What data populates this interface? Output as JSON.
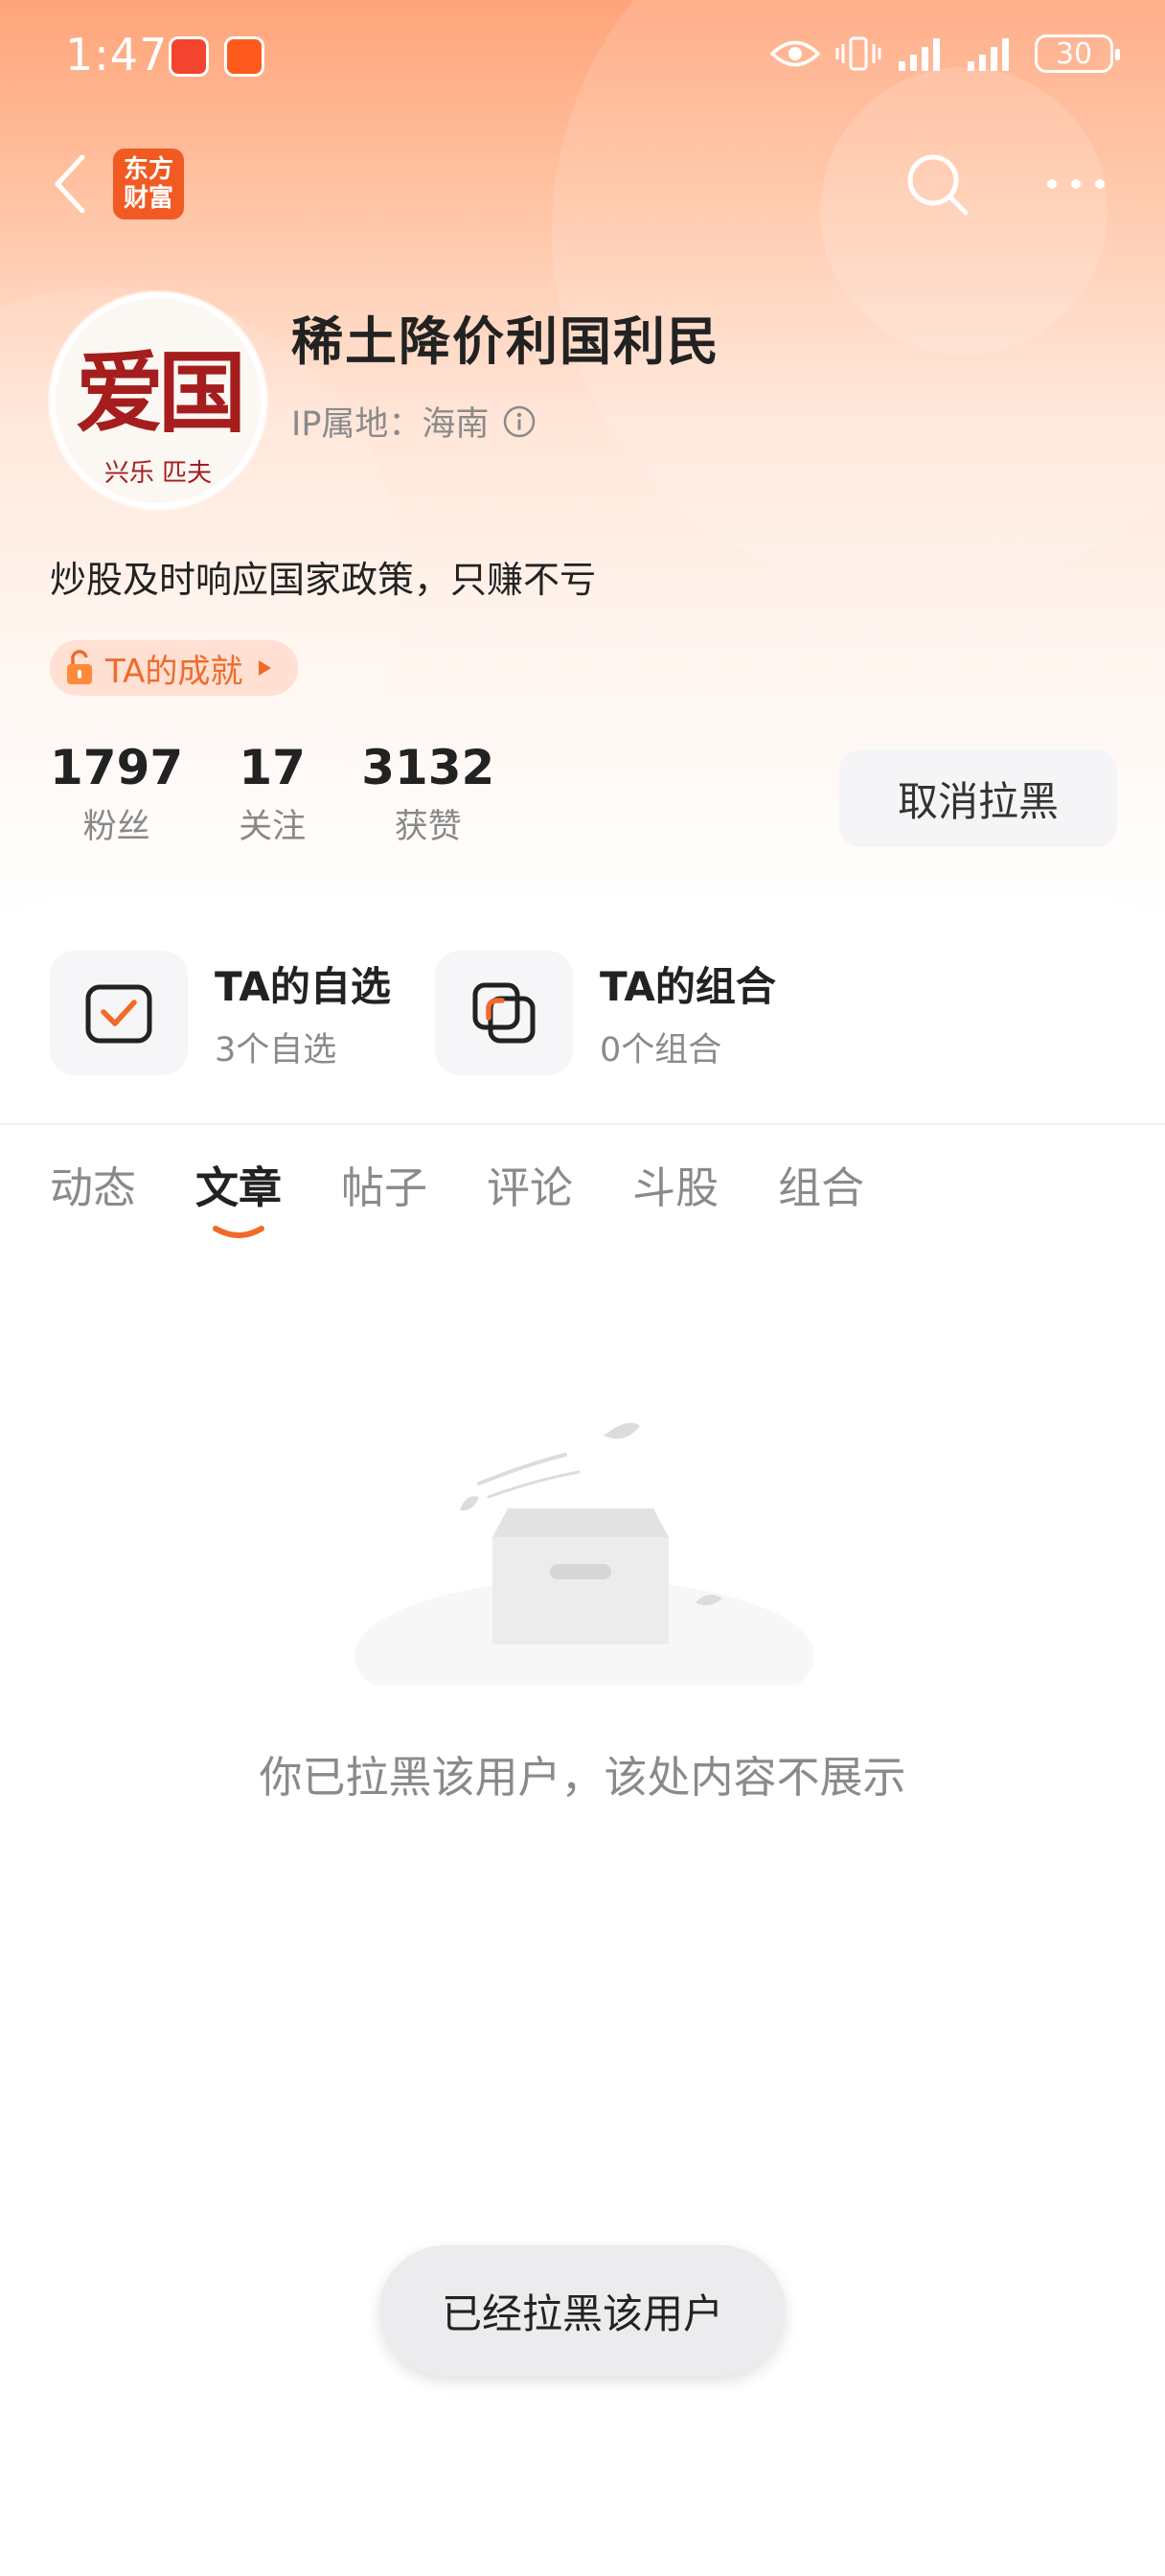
{
  "status_bar": {
    "time": "1:47",
    "battery": "30"
  },
  "nav": {
    "logo_line1": "东方",
    "logo_line2": "财富"
  },
  "profile": {
    "avatar_text": "爱国",
    "avatar_subtext": "兴乐 匹夫",
    "username": "稀土降价利国利民",
    "ip_location": "IP属地：海南",
    "bio": "炒股及时响应国家政策，只赚不亏",
    "achievement_label": "TA的成就"
  },
  "stats": [
    {
      "value": "1797",
      "label": "粉丝"
    },
    {
      "value": "17",
      "label": "关注"
    },
    {
      "value": "3132",
      "label": "获赞"
    }
  ],
  "unblock_button": "取消拉黑",
  "shortcuts": [
    {
      "title": "TA的自选",
      "subtitle": "3个自选"
    },
    {
      "title": "TA的组合",
      "subtitle": "0个组合"
    }
  ],
  "tabs": [
    "动态",
    "文章",
    "帖子",
    "评论",
    "斗股",
    "组合"
  ],
  "active_tab": "文章",
  "empty_message": "你已拉黑该用户，该处内容不展示",
  "toast": "已经拉黑该用户",
  "colors": {
    "accent": "#f06a2a",
    "brand": "#f15a22"
  }
}
